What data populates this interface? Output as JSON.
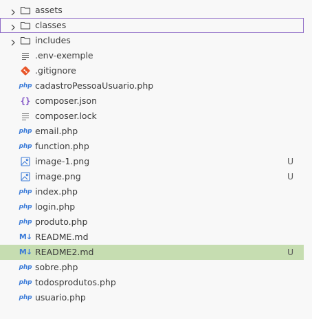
{
  "explorer": {
    "items": [
      {
        "kind": "folder",
        "label": "assets",
        "icon": "folder-icon",
        "status": ""
      },
      {
        "kind": "folder",
        "label": "classes",
        "icon": "folder-icon",
        "status": ""
      },
      {
        "kind": "folder",
        "label": "includes",
        "icon": "folder-icon",
        "status": ""
      },
      {
        "kind": "file",
        "label": ".env-exemple",
        "icon": "text-lines-icon",
        "status": ""
      },
      {
        "kind": "file",
        "label": ".gitignore",
        "icon": "git-icon",
        "status": ""
      },
      {
        "kind": "file",
        "label": "cadastroPessoaUsuario.php",
        "icon": "php-icon",
        "status": ""
      },
      {
        "kind": "file",
        "label": "composer.json",
        "icon": "json-braces-icon",
        "status": ""
      },
      {
        "kind": "file",
        "label": "composer.lock",
        "icon": "text-lines-icon",
        "status": ""
      },
      {
        "kind": "file",
        "label": "email.php",
        "icon": "php-icon",
        "status": ""
      },
      {
        "kind": "file",
        "label": "function.php",
        "icon": "php-icon",
        "status": ""
      },
      {
        "kind": "file",
        "label": "image-1.png",
        "icon": "image-icon",
        "status": "U"
      },
      {
        "kind": "file",
        "label": "image.png",
        "icon": "image-icon",
        "status": "U"
      },
      {
        "kind": "file",
        "label": "index.php",
        "icon": "php-icon",
        "status": ""
      },
      {
        "kind": "file",
        "label": "login.php",
        "icon": "php-icon",
        "status": ""
      },
      {
        "kind": "file",
        "label": "produto.php",
        "icon": "php-icon",
        "status": ""
      },
      {
        "kind": "file",
        "label": "README.md",
        "icon": "markdown-icon",
        "status": ""
      },
      {
        "kind": "file",
        "label": "README2.md",
        "icon": "markdown-icon",
        "status": "U"
      },
      {
        "kind": "file",
        "label": "sobre.php",
        "icon": "php-icon",
        "status": ""
      },
      {
        "kind": "file",
        "label": "todosprodutos.php",
        "icon": "php-icon",
        "status": ""
      },
      {
        "kind": "file",
        "label": "usuario.php",
        "icon": "php-icon",
        "status": ""
      }
    ],
    "focused_label": "classes",
    "selected_label": "README2.md",
    "icon_glyphs": {
      "php": "php",
      "markdown": "M↓",
      "json": "{}"
    }
  },
  "colors": {
    "background": "#f8f8f8",
    "text": "#3b3b3b",
    "focus_outline": "#8f6cc7",
    "selected_row": "#c6ddb1",
    "php_blue": "#3b7bd8",
    "git_orange": "#e8562a",
    "json_purple": "#7c4dc4"
  }
}
